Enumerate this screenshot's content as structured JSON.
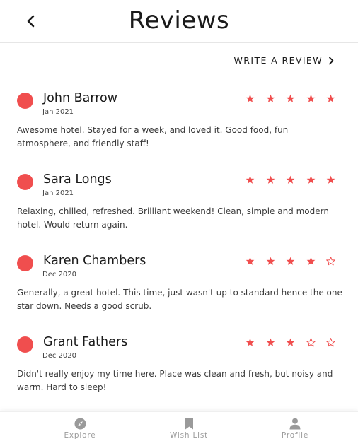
{
  "header": {
    "title": "Reviews",
    "back_icon": "chevron-left-icon"
  },
  "actions": {
    "write_review_label": "WRITE A REVIEW"
  },
  "colors": {
    "accent": "#f04e4e",
    "tab_inactive": "#9a9a9a"
  },
  "reviews": [
    {
      "name": "John Barrow",
      "date": "Jan 2021",
      "rating": 5,
      "text": "Awesome hotel. Stayed for a week, and loved it. Good food, fun atmosphere, and friendly staff!"
    },
    {
      "name": "Sara Longs",
      "date": "Jan 2021",
      "rating": 5,
      "text": "Relaxing, chilled, refreshed. Brilliant weekend! Clean, simple and modern hotel. Would return again."
    },
    {
      "name": "Karen Chambers",
      "date": "Dec 2020",
      "rating": 4,
      "text": "Generally, a great hotel. This time, just wasn't up to standard hence the one star down. Needs a good scrub."
    },
    {
      "name": "Grant Fathers",
      "date": "Dec 2020",
      "rating": 3,
      "text": "Didn't really enjoy my time here. Place was clean and fresh, but noisy and warm. Hard to sleep!"
    }
  ],
  "tabbar": {
    "tabs": [
      {
        "label": "Explore",
        "icon": "compass-icon"
      },
      {
        "label": "Wish List",
        "icon": "bookmark-icon"
      },
      {
        "label": "Profile",
        "icon": "person-icon"
      }
    ]
  }
}
